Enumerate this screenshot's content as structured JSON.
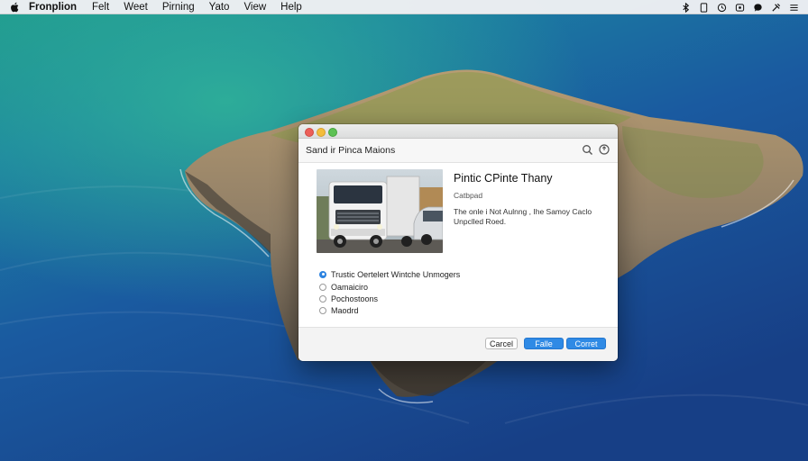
{
  "menubar": {
    "items": [
      "Fronplion",
      "Felt",
      "Weet",
      "Pirning",
      "Yato",
      "View",
      "Help"
    ],
    "status_icons": [
      "bluetooth-icon",
      "document-icon",
      "clock-icon",
      "control-icon",
      "speech-bubble-icon",
      "tools-icon",
      "list-icon"
    ]
  },
  "dialog": {
    "title": "Sand ir Pinca Maions",
    "item_title": "Pintic CPinte Thany",
    "item_subtitle": "Catbpad",
    "description_line1": "The onle i Not Aulnng , Ihe Samoy Caclo",
    "description_line2": "Unpclled Roed.",
    "options": [
      {
        "label": "Trustic Oertelert Wintche Unmogers",
        "selected": true
      },
      {
        "label": "Oamaiciro",
        "selected": false
      },
      {
        "label": "Pochostoons",
        "selected": false
      },
      {
        "label": "Maodrd",
        "selected": false
      }
    ],
    "buttons": {
      "cancel": "Carcel",
      "file": "Falle",
      "correct": "Corret"
    }
  },
  "colors": {
    "accent": "#2f8ae5",
    "ocean": "#1e4f8f",
    "window_bg": "#ffffff"
  }
}
